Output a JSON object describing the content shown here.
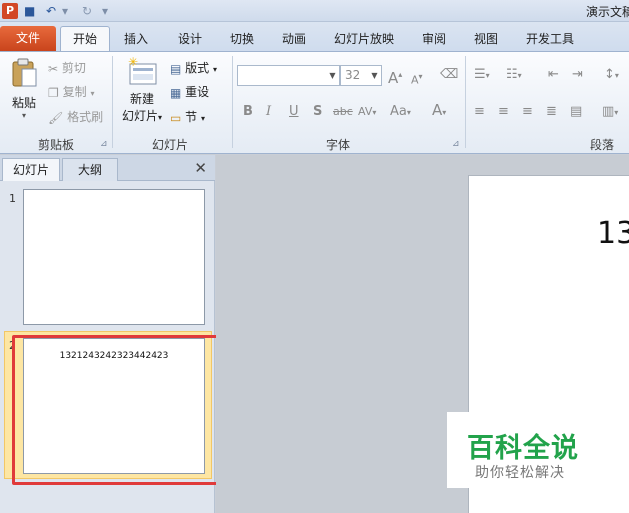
{
  "titlebar": {
    "title": "演示文稿",
    "undo": "↶",
    "redo": "↻",
    "save": "■",
    "customize": "▾"
  },
  "tabs": [
    "文件",
    "开始",
    "插入",
    "设计",
    "切换",
    "动画",
    "幻灯片放映",
    "审阅",
    "视图",
    "开发工具"
  ],
  "ribbon": {
    "clipboard": {
      "paste": "粘贴",
      "cut": "剪切",
      "copy": "复制",
      "format_painter": "格式刷",
      "label": "剪贴板"
    },
    "slides": {
      "new_slide_line1": "新建",
      "new_slide_line2": "幻灯片",
      "layout": "版式",
      "reset": "重设",
      "section": "节",
      "label": "幻灯片"
    },
    "font": {
      "font_name": "",
      "font_size": "32",
      "grow": "A",
      "shrink": "A",
      "bold": "B",
      "italic": "I",
      "underline": "U",
      "shadow": "S",
      "strike": "abc",
      "spacing": "AV",
      "case": "Aa",
      "color": "A",
      "label": "字体"
    },
    "paragraph": {
      "label": "段落"
    }
  },
  "pane": {
    "tab_slides": "幻灯片",
    "tab_outline": "大纲",
    "close": "✕",
    "slides": [
      {
        "number": "1",
        "text": ""
      },
      {
        "number": "2",
        "text": "1321243242323442423"
      }
    ]
  },
  "main": {
    "slide_text": "13"
  },
  "watermark": {
    "title": "百科全说",
    "subtitle": "助你轻松解决"
  },
  "colors": {
    "file_tab": "#d24726",
    "highlight": "#e03a3a",
    "watermark_green": "#22a34b"
  }
}
